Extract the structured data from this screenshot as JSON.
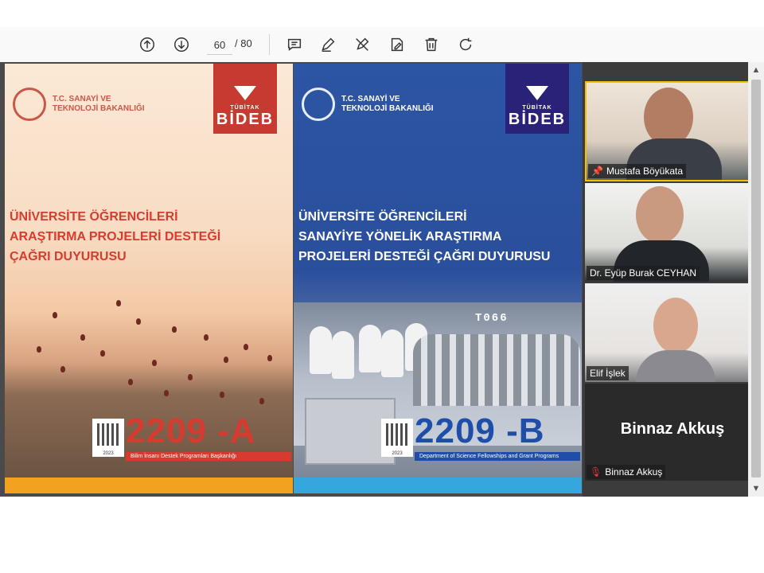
{
  "toolbar": {
    "page_current": "60",
    "page_total": "/ 80",
    "buttons": [
      "previous-page",
      "next-page",
      "comment",
      "draw",
      "erase",
      "sign",
      "delete",
      "rotate"
    ]
  },
  "slide_a": {
    "ministry": "T.C. SANAYİ VE\nTEKNOLOJİ BAKANLIĞI",
    "logo_top": "TÜBİTAK",
    "logo_main": "BİDEB",
    "headline": [
      "ÜNİVERSİTE ÖĞRENCİLERİ",
      "ARAŞTIRMA PROJELERİ DESTEĞİ",
      "ÇAĞRI DUYURUSU"
    ],
    "code": "2209 -A",
    "subtitle": "Bilim İnsanı Destek Programları Başkanlığı",
    "year": "2023",
    "accent": "#d73b2f"
  },
  "slide_b": {
    "ministry": "T.C. SANAYİ VE\nTEKNOLOJİ BAKANLIĞI",
    "logo_top": "TÜBİTAK",
    "logo_main": "BİDEB",
    "headline": [
      "ÜNİVERSİTE ÖĞRENCİLERİ",
      "SANAYİYE YÖNELİK ARAŞTIRMA",
      "PROJELERİ DESTEĞİ ÇAĞRI DUYURUSU"
    ],
    "plate": "T066",
    "code": "2209 -B",
    "subtitle": "Department of Science Fellowships and Grant Programs",
    "year": "2023",
    "accent": "#1f4ea8"
  },
  "participants": [
    {
      "name": "Mustafa Böyükata",
      "icon": "pin-icon",
      "active_speaker": true
    },
    {
      "name": "Dr. Eyüp Burak CEYHAN"
    },
    {
      "name": "Elif İşlek"
    },
    {
      "name": "Binnaz Akkuş",
      "icon": "mic-muted-icon",
      "video_off": true
    }
  ]
}
